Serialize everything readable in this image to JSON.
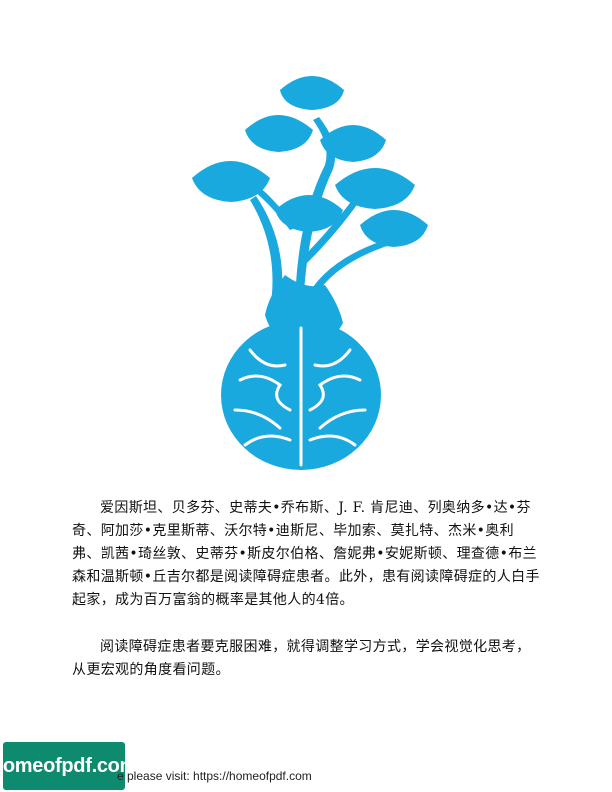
{
  "illustration": {
    "color": "#1aa9df",
    "description_icon": "tree-brain-icon"
  },
  "body": {
    "paragraph1": "爱因斯坦、贝多芬、史蒂夫•乔布斯、J. F. 肯尼迪、列奥纳多•达•芬奇、阿加莎•克里斯蒂、沃尔特•迪斯尼、毕加索、莫扎特、杰米•奥利弗、凯茜•琦丝敦、史蒂芬•斯皮尔伯格、詹妮弗•安妮斯顿、理查德•布兰森和温斯顿•丘吉尔都是阅读障碍症患者。此外，患有阅读障碍症的人白手起家，成为百万富翁的概率是其他人的4倍。",
    "paragraph2": "阅读障碍症患者要克服困难，就得调整学习方式，学会视觉化思考，从更宏观的角度看问题。"
  },
  "footer": {
    "badge_text": "homeofpdf.com",
    "visit_text": "e please visit: https://homeofpdf.com"
  },
  "colors": {
    "badge": "#0e8b6f",
    "tree": "#1aa9df"
  }
}
